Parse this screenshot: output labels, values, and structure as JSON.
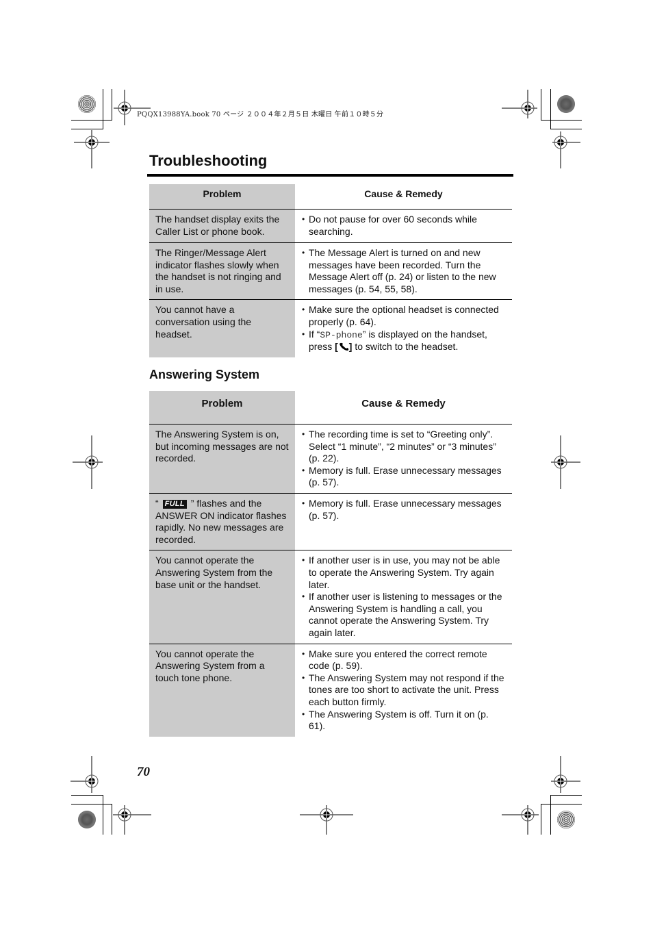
{
  "print_header": "PQQX13988YA.book  70 ページ  ２００４年２月５日  木曜日  午前１０時５分",
  "page_title": "Troubleshooting",
  "general_table": {
    "headers": {
      "problem": "Problem",
      "cause": "Cause & Remedy"
    },
    "rows": [
      {
        "problem": "The handset display exits the Caller List or phone book.",
        "remedies": [
          "Do not pause for over 60 seconds while searching."
        ]
      },
      {
        "problem": "The Ringer/Message Alert indicator flashes slowly when the handset is not ringing and in use.",
        "remedies": [
          "The Message Alert is turned on and new messages have been recorded. Turn the Message Alert off (p. 24) or listen to the new messages (p. 54, 55, 58)."
        ]
      },
      {
        "problem": "You cannot have a conversation using the headset.",
        "remedies": [
          "Make sure the optional headset is connected properly (p. 64)."
        ],
        "remedy_sp_phone": {
          "prefix": "If “",
          "display_text": "SP-phone",
          "middle": "” is displayed on the handset, press ",
          "key_open": "[",
          "key_icon": "talk-phone-icon",
          "key_close": "]",
          "suffix": " to switch to the headset."
        }
      }
    ]
  },
  "answering_section": {
    "heading": "Answering System",
    "headers": {
      "problem": "Problem",
      "cause": "Cause & Remedy"
    },
    "rows": [
      {
        "problem": "The Answering System is on, but incoming messages are not recorded.",
        "remedies": [
          "The recording time is set to “Greeting only”. Select “1 minute”, “2 minutes” or “3 minutes” (p. 22).",
          "Memory is full. Erase unnecessary messages (p. 57)."
        ]
      },
      {
        "problem_prefix": "“ ",
        "problem_badge": "FULL",
        "problem_suffix": " ” flashes and the ANSWER ON indicator flashes rapidly. No new messages are recorded.",
        "remedies": [
          "Memory is full. Erase unnecessary messages (p. 57)."
        ]
      },
      {
        "problem": "You cannot operate the Answering System from the base unit or the handset.",
        "remedies": [
          "If another user is in use, you may not be able to operate the Answering System. Try again later.",
          "If another user is listening to messages or the Answering System is handling a call, you cannot operate the Answering System. Try again later."
        ]
      },
      {
        "problem": "You cannot operate the Answering System from a touch tone phone.",
        "remedies": [
          "Make sure you entered the correct remote code (p. 59).",
          "The Answering System may not respond if the tones are too short to activate the unit. Press each button firmly.",
          "The Answering System is off. Turn it on (p. 61)."
        ]
      }
    ]
  },
  "page_number": "70"
}
